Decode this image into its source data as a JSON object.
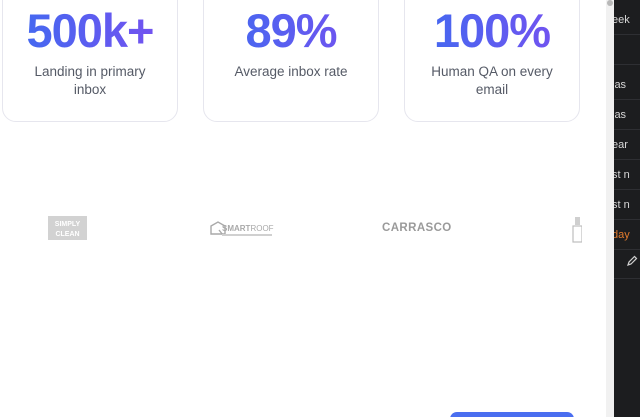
{
  "stats": [
    {
      "value": "500k+",
      "label": "Landing in primary inbox"
    },
    {
      "value": "89%",
      "label": "Average inbox rate"
    },
    {
      "value": "100%",
      "label": "Human QA on every email"
    }
  ],
  "logos": {
    "simply": "SIMPLY\nCLEAN",
    "smartroof": "SMARTROOF",
    "carrasco": "CARRASCO"
  },
  "sidebar": {
    "items": [
      "eek",
      "las",
      "las",
      "ear",
      "st n",
      "st n",
      "day"
    ]
  },
  "colors": {
    "accent_start": "#3d6cf0",
    "accent_end": "#7a4ff0",
    "sidebar_bg": "#1c1d1f",
    "highlight": "#e07a2c"
  }
}
